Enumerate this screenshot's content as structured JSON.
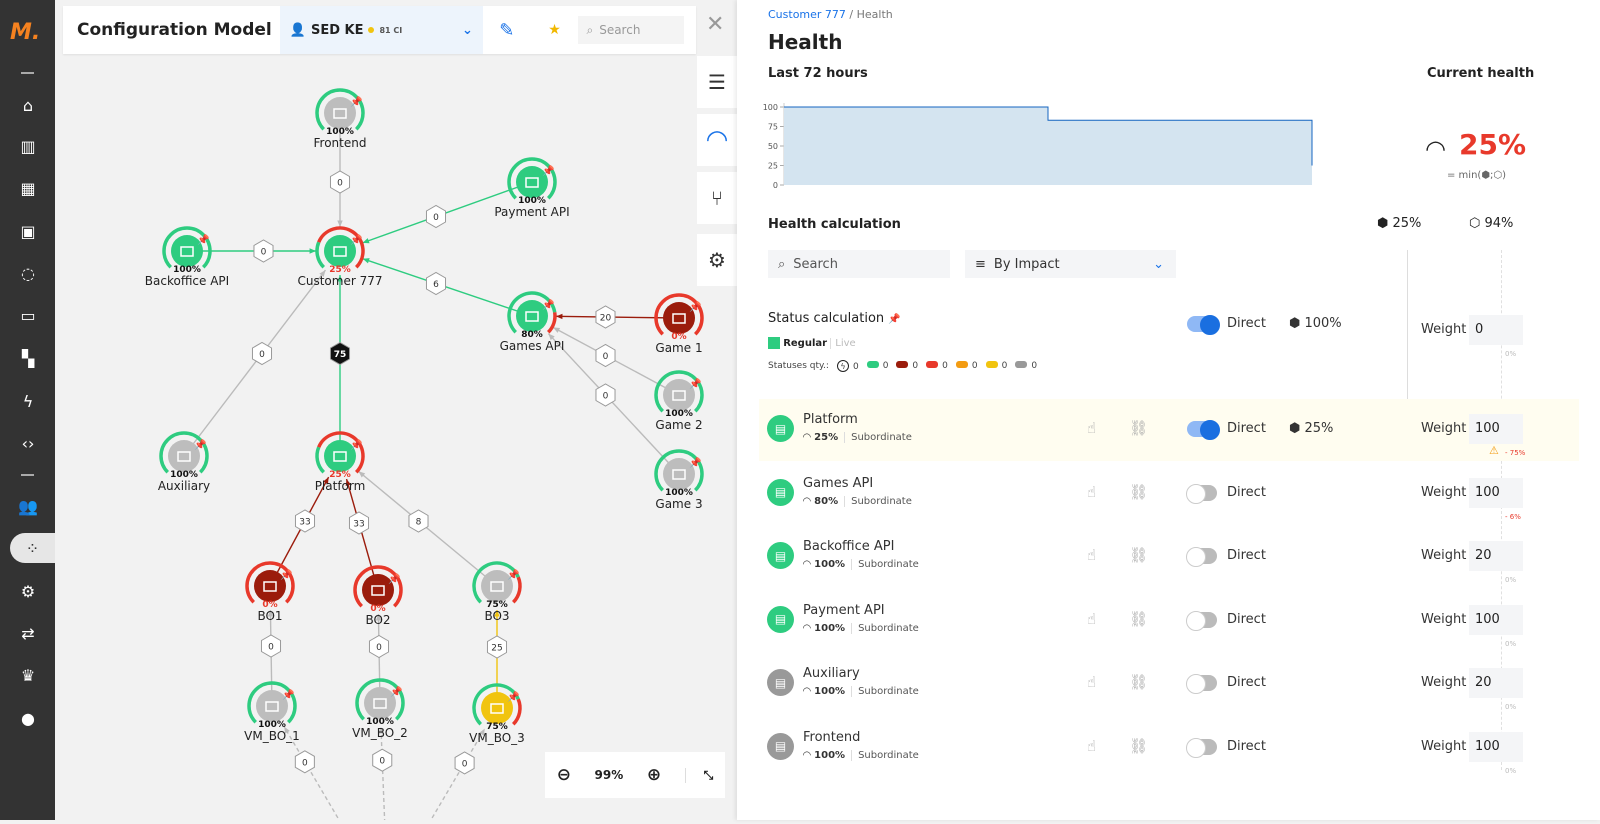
{
  "sidebar": {
    "logo": "M.",
    "items": [
      {
        "name": "home",
        "glyph": "⌂"
      },
      {
        "name": "map",
        "glyph": "▥"
      },
      {
        "name": "grid",
        "glyph": "▦"
      },
      {
        "name": "inbox",
        "glyph": "▣"
      },
      {
        "name": "sync",
        "glyph": "◌"
      },
      {
        "name": "ruler",
        "glyph": "▭"
      },
      {
        "name": "widgets",
        "glyph": "▚"
      },
      {
        "name": "bolt",
        "glyph": "ϟ"
      },
      {
        "name": "code",
        "glyph": "‹›"
      },
      {
        "name": "users",
        "glyph": "👥"
      },
      {
        "name": "topology",
        "glyph": "⁘"
      },
      {
        "name": "settings",
        "glyph": "⚙"
      },
      {
        "name": "swap",
        "glyph": "⇄"
      },
      {
        "name": "crown",
        "glyph": "♛"
      },
      {
        "name": "account",
        "glyph": "●"
      }
    ]
  },
  "topbar": {
    "title": "Configuration Model",
    "scope": "SED KE",
    "scope_count": "81 CI",
    "search_placeholder": "Search"
  },
  "graph": {
    "zoom": "99%",
    "nodes": [
      {
        "id": "frontend",
        "label": "Frontend",
        "pct": "100%",
        "value": 100,
        "fill": "#bdbdbd",
        "bad": false
      },
      {
        "id": "payment",
        "label": "Payment API",
        "pct": "100%",
        "value": 100,
        "fill": "#2ecc80",
        "bad": false
      },
      {
        "id": "backoffice",
        "label": "Backoffice API",
        "pct": "100%",
        "value": 100,
        "fill": "#2ecc80",
        "bad": false
      },
      {
        "id": "customer",
        "label": "Customer 777",
        "pct": "25%",
        "value": 25,
        "fill": "#2ecc80",
        "bad": true
      },
      {
        "id": "games",
        "label": "Games API",
        "pct": "80%",
        "value": 80,
        "fill": "#2ecc80",
        "bad": false
      },
      {
        "id": "game1",
        "label": "Game 1",
        "pct": "0%",
        "value": 0,
        "fill": "#9b1c0c",
        "bad": true
      },
      {
        "id": "game2",
        "label": "Game 2",
        "pct": "100%",
        "value": 100,
        "fill": "#bdbdbd",
        "bad": false
      },
      {
        "id": "game3",
        "label": "Game 3",
        "pct": "100%",
        "value": 100,
        "fill": "#bdbdbd",
        "bad": false
      },
      {
        "id": "auxiliary",
        "label": "Auxiliary",
        "pct": "100%",
        "value": 100,
        "fill": "#bdbdbd",
        "bad": false
      },
      {
        "id": "platform",
        "label": "Platform",
        "pct": "25%",
        "value": 25,
        "fill": "#2ecc80",
        "bad": true
      },
      {
        "id": "bo1",
        "label": "BO1",
        "pct": "0%",
        "value": 0,
        "fill": "#9b1c0c",
        "bad": true
      },
      {
        "id": "bo2",
        "label": "BO2",
        "pct": "0%",
        "value": 0,
        "fill": "#9b1c0c",
        "bad": true
      },
      {
        "id": "bo3",
        "label": "BO3",
        "pct": "75%",
        "value": 75,
        "fill": "#bdbdbd",
        "bad": false
      },
      {
        "id": "vm1",
        "label": "VM_BO_1",
        "pct": "100%",
        "value": 100,
        "fill": "#bdbdbd",
        "bad": false
      },
      {
        "id": "vm2",
        "label": "VM_BO_2",
        "pct": "100%",
        "value": 100,
        "fill": "#bdbdbd",
        "bad": false
      },
      {
        "id": "vm3",
        "label": "VM_BO_3",
        "pct": "75%",
        "value": 75,
        "fill": "#f1c40f",
        "bad": false
      }
    ],
    "edges": [
      {
        "from": "frontend",
        "to": "customer",
        "weight": "0",
        "color": "#bbbbbb"
      },
      {
        "from": "payment",
        "to": "customer",
        "weight": "0",
        "color": "#2ecc80"
      },
      {
        "from": "backoffice",
        "to": "customer",
        "weight": "0",
        "color": "#2ecc80"
      },
      {
        "from": "games",
        "to": "customer",
        "weight": "6",
        "color": "#2ecc80"
      },
      {
        "from": "platform",
        "to": "customer",
        "weight": "75",
        "color": "#2ecc80",
        "highlight": true
      },
      {
        "from": "auxiliary",
        "to": "customer",
        "weight": "0",
        "color": "#bbbbbb"
      },
      {
        "from": "game1",
        "to": "games",
        "weight": "20",
        "color": "#9b1c0c"
      },
      {
        "from": "game2",
        "to": "games",
        "weight": "0",
        "color": "#bbbbbb"
      },
      {
        "from": "game3",
        "to": "games",
        "weight": "0",
        "color": "#bbbbbb"
      },
      {
        "from": "bo1",
        "to": "platform",
        "weight": "33",
        "color": "#9b1c0c"
      },
      {
        "from": "bo2",
        "to": "platform",
        "weight": "33",
        "color": "#9b1c0c"
      },
      {
        "from": "bo3",
        "to": "platform",
        "weight": "8",
        "color": "#bbbbbb"
      },
      {
        "from": "vm1",
        "to": "bo1",
        "weight": "0",
        "color": "#bbbbbb"
      },
      {
        "from": "vm2",
        "to": "bo2",
        "weight": "0",
        "color": "#bbbbbb"
      },
      {
        "from": "vm3",
        "to": "bo3",
        "weight": "25",
        "color": "#f1c40f"
      },
      {
        "from": "below1",
        "to": "vm1",
        "weight": "0",
        "color": "#bbbbbb",
        "dashed": true
      },
      {
        "from": "below2",
        "to": "vm2",
        "weight": "0",
        "color": "#bbbbbb",
        "dashed": true
      },
      {
        "from": "below3",
        "to": "vm3",
        "weight": "0",
        "color": "#bbbbbb",
        "dashed": true
      }
    ]
  },
  "panel": {
    "breadcrumb_link": "Customer 777",
    "breadcrumb_sep": " / ",
    "breadcrumb_current": "Health",
    "title": "Health",
    "history_title": "Last 72 hours",
    "current_title": "Current health",
    "current_value": "25%",
    "current_formula": "= min(⬢;⬡)",
    "calc_title": "Health calculation",
    "calc_a": "25%",
    "calc_b": "94%",
    "search_placeholder": "Search",
    "sort_label": "By Impact",
    "status_calc": {
      "title": "Status calculation",
      "mode": "Regular",
      "mode_alt": "Live",
      "direct": "Direct",
      "value": "100%",
      "weight_label": "Weight",
      "weight": "0",
      "delta": "0%",
      "qty_label": "Statuses qty.:",
      "counts": [
        {
          "color": "#222",
          "value": "0",
          "icon": true
        },
        {
          "color": "#2ecc80",
          "value": "0"
        },
        {
          "color": "#9b1c0c",
          "value": "0"
        },
        {
          "color": "#e8392b",
          "value": "0"
        },
        {
          "color": "#f39c12",
          "value": "0"
        },
        {
          "color": "#f1c40f",
          "value": "0"
        },
        {
          "color": "#999999",
          "value": "0"
        }
      ]
    },
    "rows": [
      {
        "name": "Platform",
        "health": "25%",
        "type": "Subordinate",
        "direct": "Direct",
        "on": true,
        "value": "25%",
        "weight_label": "Weight",
        "weight": "100",
        "delta": "- 75%",
        "color": "#2ecc80",
        "warn": true
      },
      {
        "name": "Games API",
        "health": "80%",
        "type": "Subordinate",
        "direct": "Direct",
        "on": false,
        "weight_label": "Weight",
        "weight": "100",
        "delta": "- 6%",
        "color": "#2ecc80"
      },
      {
        "name": "Backoffice API",
        "health": "100%",
        "type": "Subordinate",
        "direct": "Direct",
        "on": false,
        "weight_label": "Weight",
        "weight": "20",
        "delta": "0%",
        "color": "#2ecc80"
      },
      {
        "name": "Payment API",
        "health": "100%",
        "type": "Subordinate",
        "direct": "Direct",
        "on": false,
        "weight_label": "Weight",
        "weight": "100",
        "delta": "0%",
        "color": "#2ecc80"
      },
      {
        "name": "Auxiliary",
        "health": "100%",
        "type": "Subordinate",
        "direct": "Direct",
        "on": false,
        "weight_label": "Weight",
        "weight": "20",
        "delta": "0%",
        "color": "#999999"
      },
      {
        "name": "Frontend",
        "health": "100%",
        "type": "Subordinate",
        "direct": "Direct",
        "on": false,
        "weight_label": "Weight",
        "weight": "100",
        "delta": "0%",
        "color": "#999999"
      }
    ]
  },
  "chart_data": {
    "type": "area",
    "title": "Last 72 hours",
    "x": [
      0,
      1,
      2,
      3,
      4,
      5,
      6,
      7,
      8,
      9,
      10,
      11,
      12,
      13,
      14,
      15,
      16,
      17,
      18,
      19,
      20
    ],
    "values": [
      100,
      100,
      100,
      100,
      100,
      100,
      100,
      100,
      100,
      100,
      83,
      83,
      83,
      83,
      83,
      83,
      83,
      83,
      83,
      83,
      25
    ],
    "ylim": [
      0,
      100
    ],
    "yticks": [
      "0",
      "25",
      "50",
      "75",
      "100"
    ],
    "color": "#1565c0",
    "fill": "#d4e4f0"
  }
}
